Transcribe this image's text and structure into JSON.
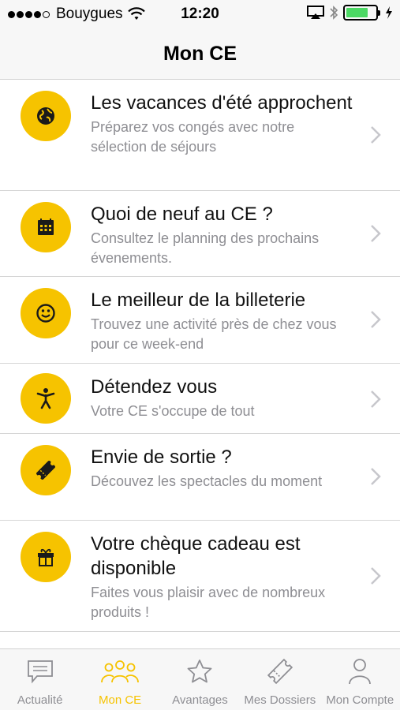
{
  "status_bar": {
    "carrier": "Bouygues",
    "time": "12:20",
    "battery_level": 0.75
  },
  "nav": {
    "title": "Mon CE"
  },
  "items": [
    {
      "icon": "globe-icon",
      "title": "Les vacances d'été approchent",
      "subtitle": "Préparez vos congés avec notre sélection de séjours"
    },
    {
      "icon": "calendar-icon",
      "title": "Quoi de neuf au CE ?",
      "subtitle": "Consultez le planning des prochains évenements."
    },
    {
      "icon": "smiley-icon",
      "title": "Le meilleur de la billeterie",
      "subtitle": "Trouvez une activité près de chez vous pour ce week-end"
    },
    {
      "icon": "person-relax-icon",
      "title": "Détendez vous",
      "subtitle": "Votre CE s'occupe de tout"
    },
    {
      "icon": "ticket-icon",
      "title": "Envie de sortie ?",
      "subtitle": "Découvez les spectacles du moment"
    },
    {
      "icon": "gift-icon",
      "title": "Votre chèque cadeau est disponible",
      "subtitle": "Faites vous plaisir avec de nombreux produits !"
    }
  ],
  "tabs": [
    {
      "label": "Actualité",
      "icon": "chat-icon",
      "active": false
    },
    {
      "label": "Mon CE",
      "icon": "group-icon",
      "active": true
    },
    {
      "label": "Avantages",
      "icon": "star-icon",
      "active": false
    },
    {
      "label": "Mes Dossiers",
      "icon": "ticket-icon",
      "active": false
    },
    {
      "label": "Mon Compte",
      "icon": "user-icon",
      "active": false
    }
  ],
  "colors": {
    "accent": "#f6c300",
    "secondary_text": "#8e8e93",
    "battery": "#4cd964"
  }
}
